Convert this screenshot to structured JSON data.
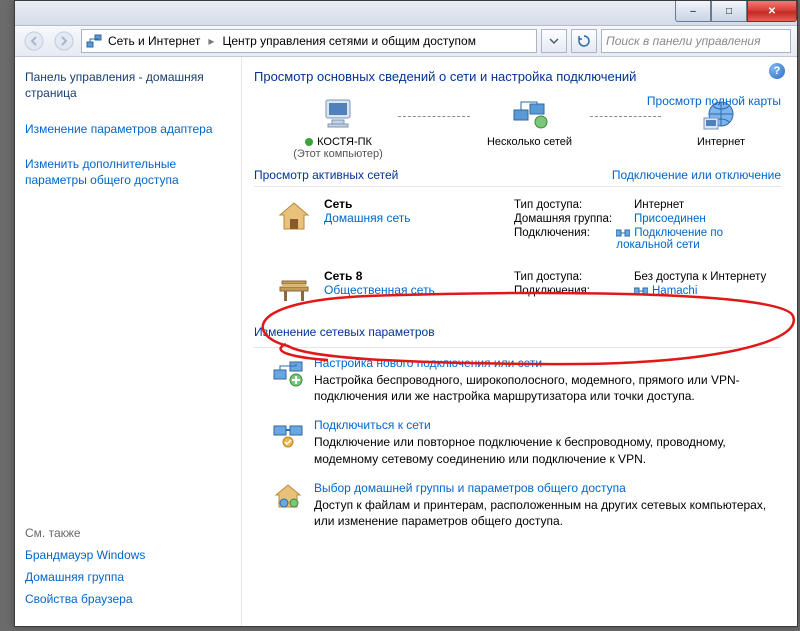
{
  "titlebar": {
    "minimize": "–",
    "maximize": "□",
    "close": "✕"
  },
  "addressbar": {
    "segments": [
      "Сеть и Интернет",
      "Центр управления сетями и общим доступом"
    ],
    "search_placeholder": "Поиск в панели управления"
  },
  "sidebar": {
    "home": "Панель управления - домашняя страница",
    "links": [
      "Изменение параметров адаптера",
      "Изменить дополнительные параметры общего доступа"
    ],
    "seealso_hdr": "См. также",
    "seealso": [
      "Брандмауэр Windows",
      "Домашняя группа",
      "Свойства браузера"
    ]
  },
  "main": {
    "heading": "Просмотр основных сведений о сети и настройка подключений",
    "fullmap_link": "Просмотр полной карты",
    "map": {
      "node1": "КОСТЯ-ПК",
      "node1_sub": "(Этот компьютер)",
      "node2": "Несколько сетей",
      "node3": "Интернет"
    },
    "active_hdr": "Просмотр активных сетей",
    "active_link": "Подключение или отключение",
    "net1": {
      "name": "Сеть",
      "type": "Домашняя сеть",
      "access_k": "Тип доступа:",
      "access_v": "Интернет",
      "hg_k": "Домашняя группа:",
      "hg_v": "Присоединен",
      "conn_k": "Подключения:",
      "conn_v": "Подключение по локальной сети"
    },
    "net2": {
      "name": "Сеть 8",
      "type": "Общественная сеть",
      "access_k": "Тип доступа:",
      "access_v": "Без доступа к Интернету",
      "conn_k": "Подключения:",
      "conn_v": "Hamachi"
    },
    "settings_hdr": "Изменение сетевых параметров",
    "tasks": [
      {
        "title": "Настройка нового подключения или сети",
        "desc": "Настройка беспроводного, широкополосного, модемного, прямого или VPN-подключения или же настройка маршрутизатора или точки доступа."
      },
      {
        "title": "Подключиться к сети",
        "desc": "Подключение или повторное подключение к беспроводному, проводному, модемному сетевому соединению или подключение к VPN."
      },
      {
        "title": "Выбор домашней группы и параметров общего доступа",
        "desc": "Доступ к файлам и принтерам, расположенным на других сетевых компьютерах, или изменение параметров общего доступа."
      }
    ]
  }
}
